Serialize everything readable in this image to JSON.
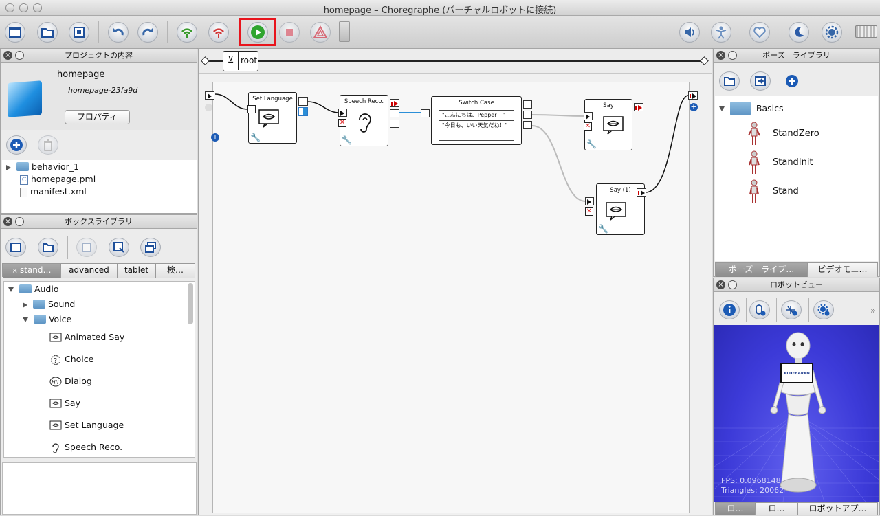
{
  "window": {
    "title": "homepage – Choregraphe (バーチャルロボットに接続)"
  },
  "project_panel": {
    "title": "プロジェクトの内容",
    "name": "homepage",
    "id": "homepage-23fa9d",
    "properties_button": "プロパティ",
    "files": [
      "behavior_1",
      "homepage.pml",
      "manifest.xml"
    ]
  },
  "box_library_panel": {
    "title": "ボックスライブラリ",
    "tabs": [
      "stand…",
      "advanced",
      "tablet",
      "検…"
    ],
    "tree": {
      "audio": "Audio",
      "sound": "Sound",
      "voice": "Voice",
      "items": [
        "Animated Say",
        "Choice",
        "Dialog",
        "Say",
        "Set Language",
        "Speech Reco."
      ]
    }
  },
  "flow": {
    "breadcrumb": "root",
    "boxes": {
      "set_language": "Set Language",
      "speech_reco": "Speech Reco.",
      "switch_case": "Switch Case",
      "say": "Say",
      "say1": "Say (1)"
    },
    "switch_cases": [
      "\"こんにちは、Pepper！\"",
      "\"今日も、いい天気だね！\""
    ]
  },
  "pose_panel": {
    "title": "ポーズ　ライブラリ",
    "folder": "Basics",
    "poses": [
      "StandZero",
      "StandInit",
      "Stand"
    ],
    "tabs": [
      "ポーズ　ライブ…",
      "ビデオモニ…"
    ]
  },
  "robot_panel": {
    "title": "ロボットビュー",
    "fps": "FPS: 0.0968148",
    "triangles": "Triangles: 20062",
    "brand": "ALDEBARAN",
    "tabs": [
      "ロ…",
      "ロ…",
      "ロボットアプ…"
    ]
  },
  "colors": {
    "highlight": "#e8141c",
    "play": "#2fa52f",
    "wifi": "#3a9b2e",
    "viewport": "#3c3ad8"
  }
}
